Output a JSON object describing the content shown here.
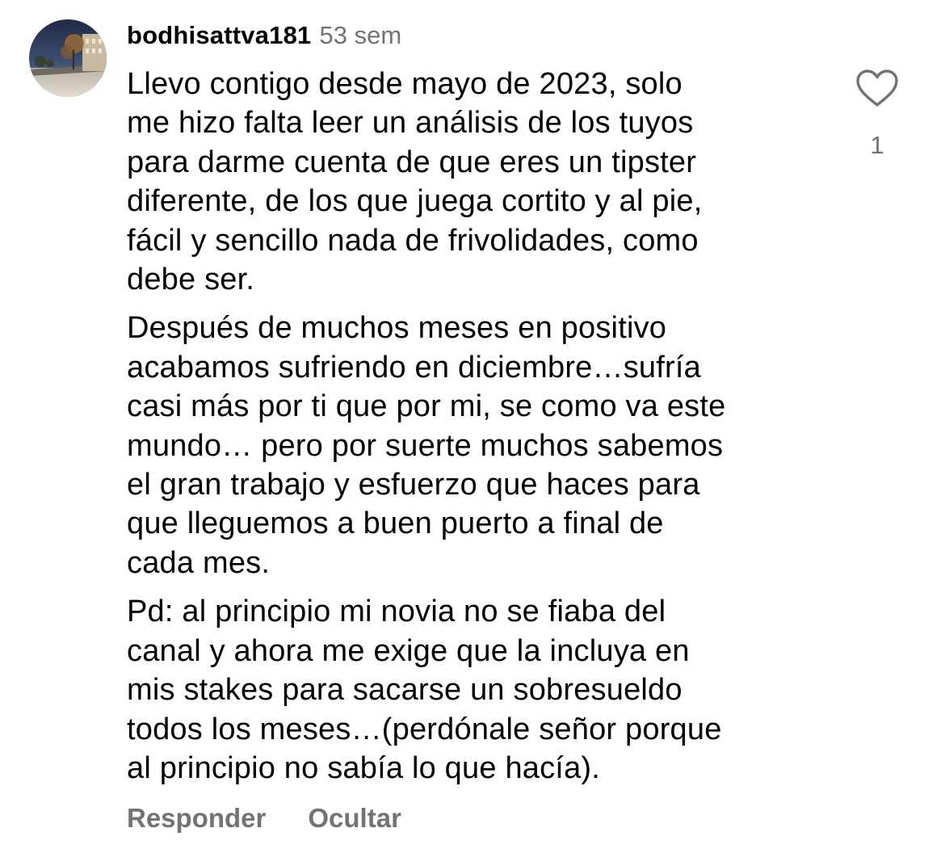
{
  "comment": {
    "username": "bodhisattva181",
    "timestamp": "53 sem",
    "paragraphs": [
      {
        "lines": [
          "Llevo contigo desde mayo de 2023, solo",
          "me hizo falta leer un análisis de los tuyos",
          "para darme cuenta de que eres un tipster",
          "diferente, de los que juega cortito y al pie,",
          "fácil y sencillo nada de frivolidades, como",
          "debe ser."
        ]
      },
      {
        "lines": [
          "Después de muchos meses en positivo",
          "acabamos sufriendo en diciembre…sufría",
          "casi más por ti que por mi, se como va este",
          "mundo… pero por suerte muchos sabemos",
          "el gran trabajo y esfuerzo que haces para",
          "que lleguemos a buen puerto a final de",
          "cada mes."
        ]
      },
      {
        "lines": [
          "Pd: al principio mi novia no se fiaba del",
          "canal y ahora me exige que la incluya en",
          "mis stakes  para sacarse un sobresueldo",
          "todos los meses…(perdónale señor porque",
          "al principio no sabía lo que hacía)."
        ]
      }
    ],
    "actions": {
      "reply_label": "Responder",
      "hide_label": "Ocultar"
    },
    "like": {
      "icon": "heart-outline-icon",
      "count": "1"
    },
    "avatar": {
      "icon": "avatar-photo"
    }
  },
  "colors": {
    "text": "#000000",
    "secondary_text": "#737373",
    "background": "#ffffff"
  }
}
